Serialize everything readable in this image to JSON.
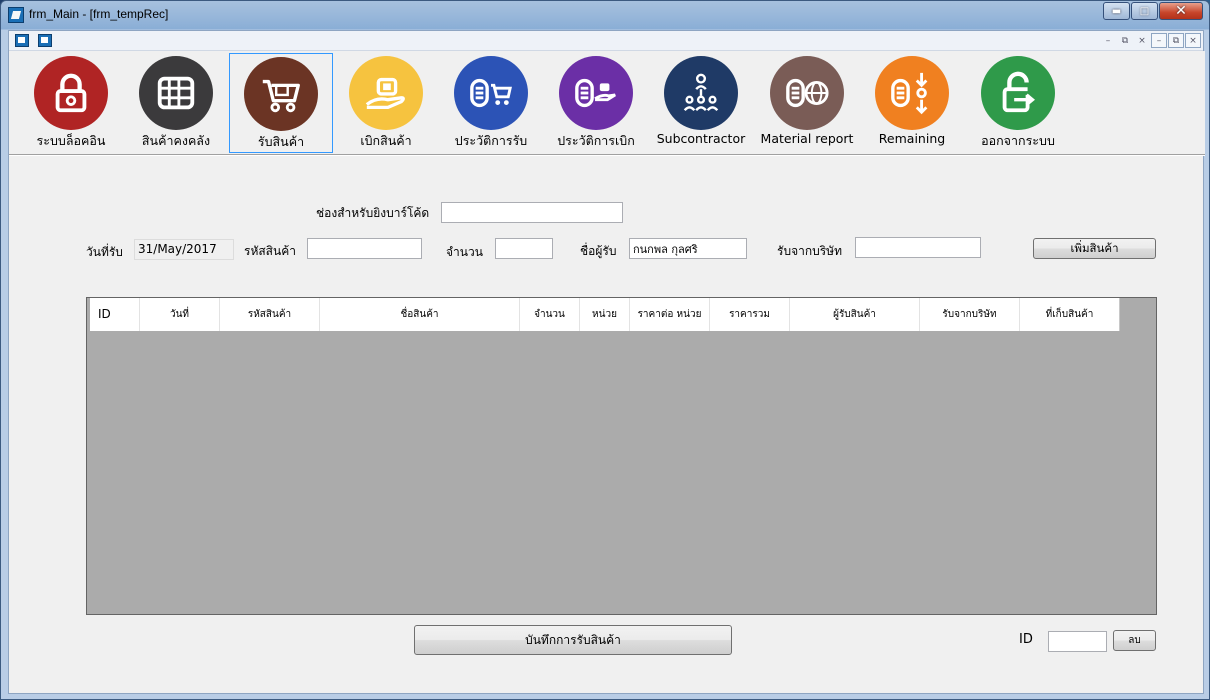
{
  "window": {
    "title": "frm_Main - [frm_tempRec]",
    "caption_buttons": [
      "minimize",
      "maximize",
      "close"
    ]
  },
  "toolbar": {
    "items": [
      {
        "id": "logout-lock",
        "label": "ระบบล็อคอิน",
        "icon": "padlock-icon",
        "color": "#b02424"
      },
      {
        "id": "inventory",
        "label": "สินค้าคงคลัง",
        "icon": "warehouse-icon",
        "color": "#3b3a3c"
      },
      {
        "id": "receive",
        "label": "รับสินค้า",
        "icon": "shopping-cart-icon",
        "color": "#6b3424",
        "active": true
      },
      {
        "id": "withdraw",
        "label": "เบิกสินค้า",
        "icon": "hand-package-icon",
        "color": "#f6c33f"
      },
      {
        "id": "receive-history",
        "label": "ประวัติการรับ",
        "icon": "receive-history-icon",
        "color": "#2c53b6"
      },
      {
        "id": "withdraw-history",
        "label": "ประวัติการเบิก",
        "icon": "withdraw-history-icon",
        "color": "#6b2fa6"
      },
      {
        "id": "subcontractor",
        "label": "Subcontractor",
        "icon": "people-network-icon",
        "color": "#1f3a66"
      },
      {
        "id": "material-report",
        "label": "Material report",
        "icon": "report-globe-icon",
        "color": "#7a5c56"
      },
      {
        "id": "remaining",
        "label": "Remaining",
        "icon": "remaining-arrows-icon",
        "color": "#f08020"
      },
      {
        "id": "exit",
        "label": "ออกจากระบบ",
        "icon": "unlock-exit-icon",
        "color": "#2f9a4a"
      }
    ]
  },
  "form": {
    "barcode_label": "ช่องสำหรับยิงบาร์โค้ด",
    "barcode_value": "",
    "date_label": "วันที่รับ",
    "date_value": "31/May/2017",
    "code_label": "รหัสสินค้า",
    "code_value": "",
    "qty_label": "จำนวน",
    "qty_value": "",
    "receiver_label": "ชื่อผู้รับ",
    "receiver_value": "กนกพล กุลศริ",
    "company_label": "รับจากบริษัท",
    "company_value": "",
    "add_button": "เพิ่มสินค้า"
  },
  "grid": {
    "columns": [
      "ID",
      "วันที่",
      "รหัสสินค้า",
      "ชื่อสินค้า",
      "จำนวน",
      "หน่วย",
      "ราคาต่อ หน่วย",
      "ราคารวม",
      "ผู้รับสินค้า",
      "รับจากบริษัท",
      "ที่เก็บสินค้า"
    ],
    "rows": []
  },
  "footer": {
    "save_button": "บันทึกการรับสินค้า",
    "id_label": "ID",
    "id_value": "",
    "delete_button": "ลบ"
  }
}
